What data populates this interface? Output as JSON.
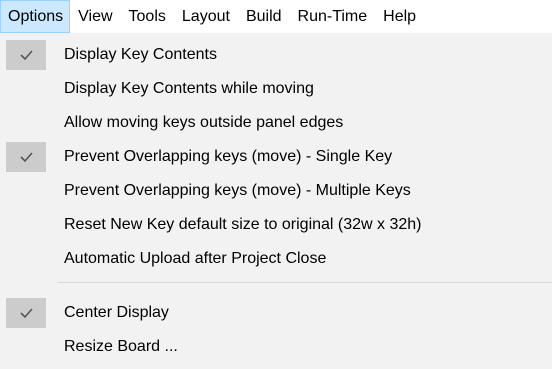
{
  "menubar": {
    "items": [
      {
        "label": "Options",
        "active": true
      },
      {
        "label": "View"
      },
      {
        "label": "Tools"
      },
      {
        "label": "Layout"
      },
      {
        "label": "Build"
      },
      {
        "label": "Run-Time"
      },
      {
        "label": "Help"
      }
    ]
  },
  "dropdown": {
    "items": [
      {
        "label": "Display Key Contents",
        "checked": true
      },
      {
        "label": "Display Key Contents while moving",
        "checked": false
      },
      {
        "label": "Allow moving keys outside panel edges",
        "checked": false
      },
      {
        "label": "Prevent Overlapping keys (move) - Single Key",
        "checked": true
      },
      {
        "label": "Prevent Overlapping keys (move) - Multiple Keys",
        "checked": false
      },
      {
        "label": "Reset New Key default size to original (32w x 32h)",
        "checked": false
      },
      {
        "label": "Automatic Upload after Project Close",
        "checked": false
      },
      {
        "label": "Center Display",
        "checked": true
      },
      {
        "label": "Resize Board ...",
        "checked": false
      }
    ]
  },
  "colors": {
    "menubar_active_bg": "#cce8ff",
    "menubar_active_border": "#99d1ff",
    "dropdown_bg": "#f2f2f2",
    "check_bg": "#cccccc",
    "check_mark": "#555555"
  }
}
